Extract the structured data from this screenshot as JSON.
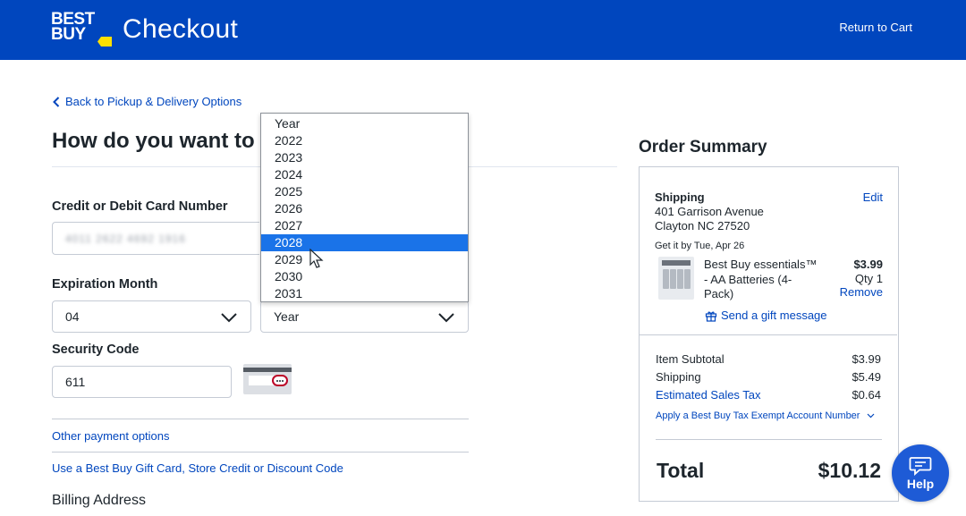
{
  "header": {
    "logo_line1": "BEST",
    "logo_line2": "BUY",
    "title": "Checkout",
    "return_link": "Return to Cart"
  },
  "main": {
    "back_link": "Back to Pickup & Delivery Options",
    "heading": "How do you want to pay?",
    "card_number_label": "Credit or Debit Card Number",
    "card_number_value": "4011 2622 4692 1916",
    "expiration_label": "Expiration Month",
    "month_value": "04",
    "year_value": "Year",
    "security_label": "Security Code",
    "security_value": "611",
    "other_payment": "Other payment options",
    "gift_card_link": "Use a Best Buy Gift Card, Store Credit or Discount Code",
    "billing_label": "Billing Address"
  },
  "year_dropdown": {
    "options": [
      "Year",
      "2022",
      "2023",
      "2024",
      "2025",
      "2026",
      "2027",
      "2028",
      "2029",
      "2030",
      "2031"
    ],
    "highlighted": "2028"
  },
  "summary": {
    "title": "Order Summary",
    "shipping_label": "Shipping",
    "edit": "Edit",
    "address_line1": "401 Garrison Avenue",
    "address_line2": "Clayton NC 27520",
    "delivery_date": "Get it by Tue, Apr 26",
    "product_line1": "Best Buy essentials™",
    "product_line2": "- AA Batteries (4-",
    "product_line3": "Pack)",
    "product_price": "$3.99",
    "product_qty": "Qty 1",
    "remove": "Remove",
    "gift_message": "Send a gift message",
    "item_subtotal_label": "Item Subtotal",
    "item_subtotal_value": "$3.99",
    "shipping_cost_label": "Shipping",
    "shipping_cost_value": "$5.49",
    "tax_label": "Estimated Sales Tax",
    "tax_value": "$0.64",
    "tax_exempt_link": "Apply a Best Buy Tax Exempt Account Number",
    "total_label": "Total",
    "total_value": "$10.12"
  },
  "help": {
    "label": "Help"
  },
  "colors": {
    "brand_blue": "#0046be",
    "brand_yellow": "#ffe000",
    "highlight": "#1a73e8"
  }
}
